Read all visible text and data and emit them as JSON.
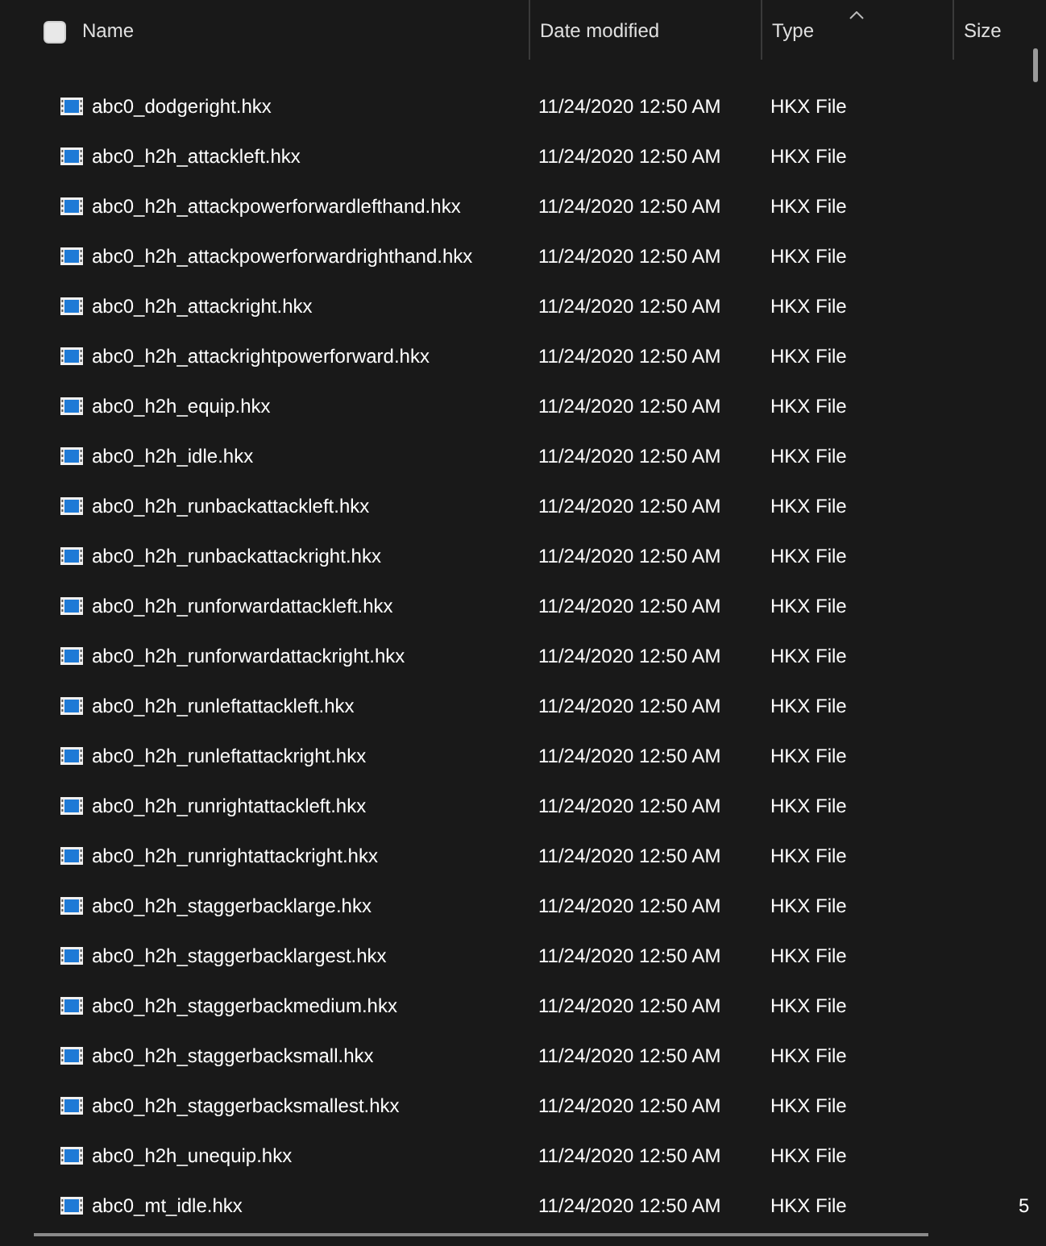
{
  "header": {
    "select_all": {
      "checked": false
    },
    "columns": [
      {
        "label": "Name",
        "sorted": false
      },
      {
        "label": "Date modified",
        "sorted": false
      },
      {
        "label": "Type",
        "sorted": true
      },
      {
        "label": "Size",
        "sorted": false
      }
    ]
  },
  "files": [
    {
      "name": "abc0_dodgeright.hkx",
      "date": "11/24/2020 12:50 AM",
      "type": "HKX File"
    },
    {
      "name": "abc0_h2h_attackleft.hkx",
      "date": "11/24/2020 12:50 AM",
      "type": "HKX File"
    },
    {
      "name": "abc0_h2h_attackpowerforwardlefthand.hkx",
      "date": "11/24/2020 12:50 AM",
      "type": "HKX File"
    },
    {
      "name": "abc0_h2h_attackpowerforwardrighthand.hkx",
      "date": "11/24/2020 12:50 AM",
      "type": "HKX File"
    },
    {
      "name": "abc0_h2h_attackright.hkx",
      "date": "11/24/2020 12:50 AM",
      "type": "HKX File"
    },
    {
      "name": "abc0_h2h_attackrightpowerforward.hkx",
      "date": "11/24/2020 12:50 AM",
      "type": "HKX File"
    },
    {
      "name": "abc0_h2h_equip.hkx",
      "date": "11/24/2020 12:50 AM",
      "type": "HKX File"
    },
    {
      "name": "abc0_h2h_idle.hkx",
      "date": "11/24/2020 12:50 AM",
      "type": "HKX File"
    },
    {
      "name": "abc0_h2h_runbackattackleft.hkx",
      "date": "11/24/2020 12:50 AM",
      "type": "HKX File"
    },
    {
      "name": "abc0_h2h_runbackattackright.hkx",
      "date": "11/24/2020 12:50 AM",
      "type": "HKX File"
    },
    {
      "name": "abc0_h2h_runforwardattackleft.hkx",
      "date": "11/24/2020 12:50 AM",
      "type": "HKX File"
    },
    {
      "name": "abc0_h2h_runforwardattackright.hkx",
      "date": "11/24/2020 12:50 AM",
      "type": "HKX File"
    },
    {
      "name": "abc0_h2h_runleftattackleft.hkx",
      "date": "11/24/2020 12:50 AM",
      "type": "HKX File"
    },
    {
      "name": "abc0_h2h_runleftattackright.hkx",
      "date": "11/24/2020 12:50 AM",
      "type": "HKX File"
    },
    {
      "name": "abc0_h2h_runrightattackleft.hkx",
      "date": "11/24/2020 12:50 AM",
      "type": "HKX File"
    },
    {
      "name": "abc0_h2h_runrightattackright.hkx",
      "date": "11/24/2020 12:50 AM",
      "type": "HKX File"
    },
    {
      "name": "abc0_h2h_staggerbacklarge.hkx",
      "date": "11/24/2020 12:50 AM",
      "type": "HKX File"
    },
    {
      "name": "abc0_h2h_staggerbacklargest.hkx",
      "date": "11/24/2020 12:50 AM",
      "type": "HKX File"
    },
    {
      "name": "abc0_h2h_staggerbackmedium.hkx",
      "date": "11/24/2020 12:50 AM",
      "type": "HKX File"
    },
    {
      "name": "abc0_h2h_staggerbacksmall.hkx",
      "date": "11/24/2020 12:50 AM",
      "type": "HKX File"
    },
    {
      "name": "abc0_h2h_staggerbacksmallest.hkx",
      "date": "11/24/2020 12:50 AM",
      "type": "HKX File"
    },
    {
      "name": "abc0_h2h_unequip.hkx",
      "date": "11/24/2020 12:50 AM",
      "type": "HKX File"
    },
    {
      "name": "abc0_mt_idle.hkx",
      "date": "11/24/2020 12:50 AM",
      "type": "HKX File",
      "size": "5"
    }
  ]
}
